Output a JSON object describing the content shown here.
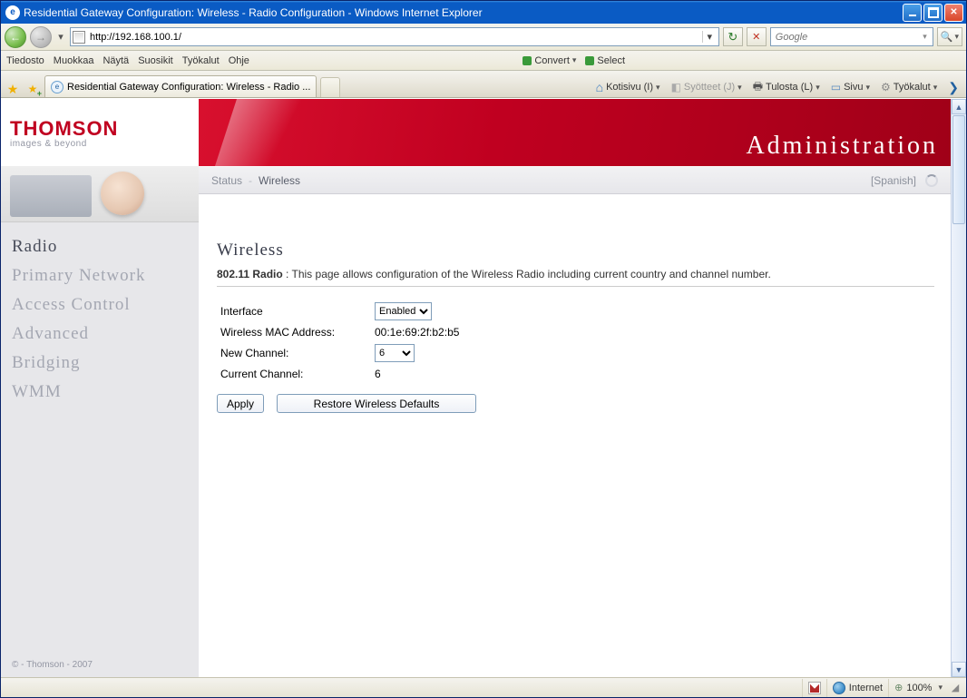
{
  "window": {
    "title": "Residential Gateway Configuration: Wireless - Radio Configuration - Windows Internet Explorer"
  },
  "nav": {
    "address": "http://192.168.100.1/",
    "search_placeholder": "Google"
  },
  "menus": {
    "file": "Tiedosto",
    "edit": "Muokkaa",
    "view": "Näytä",
    "favorites": "Suosikit",
    "tools": "Työkalut",
    "help": "Ohje",
    "convert": "Convert",
    "select": "Select"
  },
  "tabs": {
    "main": "Residential Gateway Configuration: Wireless - Radio ..."
  },
  "toolbar": {
    "home": "Kotisivu (I)",
    "feeds": "Syötteet (J)",
    "print": "Tulosta (L)",
    "page": "Sivu",
    "tools": "Työkalut"
  },
  "brand": {
    "name": "THOMSON",
    "tag": "images & beyond"
  },
  "banner": {
    "title": "Administration"
  },
  "crumb": {
    "a": "Status",
    "b": "Wireless",
    "lang": "[Spanish]"
  },
  "sidebar": {
    "items": [
      "Radio",
      "Primary Network",
      "Access Control",
      "Advanced",
      "Bridging",
      "WMM"
    ],
    "copyright": "© - Thomson - 2007"
  },
  "content": {
    "heading": "Wireless",
    "desc_label": "802.11 Radio",
    "desc_sep": " : ",
    "desc_text": "This page allows configuration of the Wireless Radio including current country and channel number.",
    "rows": {
      "interface": "Interface",
      "interface_value": "Enabled",
      "mac_label": "Wireless MAC Address:",
      "mac_value": "00:1e:69:2f:b2:b5",
      "newch_label": "New Channel:",
      "newch_value": "6",
      "curch_label": "Current Channel:",
      "curch_value": "6"
    },
    "buttons": {
      "apply": "Apply",
      "restore": "Restore Wireless Defaults"
    }
  },
  "status": {
    "zone": "Internet",
    "zoom": "100%"
  }
}
